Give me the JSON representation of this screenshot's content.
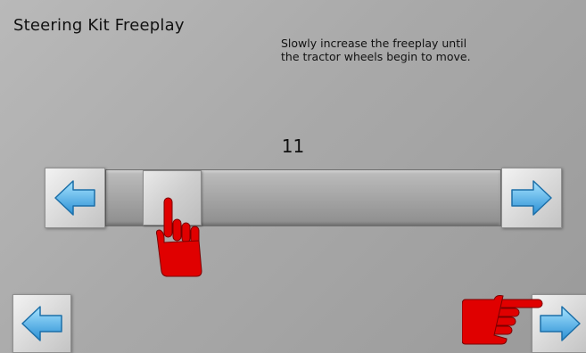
{
  "screen": {
    "title": "Steering Kit Freeplay",
    "instructions_line1": "Slowly increase the freeplay until",
    "instructions_line2": "the tractor wheels begin to move."
  },
  "slider": {
    "value": "11",
    "level_fraction": 0.12
  },
  "buttons": {
    "slider_decrease_icon": "left-arrow-icon",
    "slider_increase_icon": "right-arrow-icon",
    "nav_back_icon": "left-arrow-icon",
    "nav_next_icon": "right-arrow-icon"
  },
  "colors": {
    "arrow_light": "#8fd6ff",
    "arrow_dark": "#2a8fd4",
    "hand": "#e00000"
  }
}
